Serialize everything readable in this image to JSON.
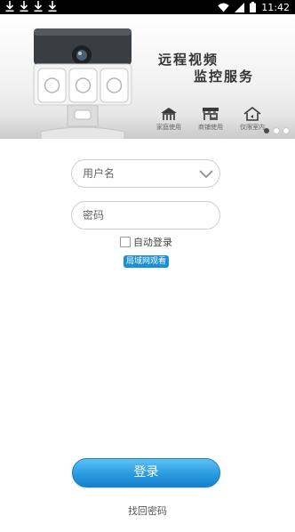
{
  "status_bar": {
    "time": "11:42",
    "download_icon_count": 4
  },
  "banner": {
    "title_line1": "远程视频",
    "title_line2": "监控服务",
    "usages": [
      {
        "label": "家庭使用",
        "icon": "house-icon"
      },
      {
        "label": "商铺使用",
        "icon": "shop-icon"
      },
      {
        "label": "仅限室内",
        "icon": "indoor-house-icon"
      }
    ],
    "pager": {
      "count": 3,
      "active_index": 0
    }
  },
  "login_form": {
    "username_placeholder": "用户名",
    "password_placeholder": "密码",
    "auto_login_label": "自动登录",
    "auto_login_checked": false,
    "lan_button_label": "局域网观看",
    "login_button_label": "登录",
    "forgot_password_label": "找回密码"
  },
  "colors": {
    "accent": "#2a9ae0",
    "status_bar": "#000000",
    "background": "#ffffff"
  }
}
